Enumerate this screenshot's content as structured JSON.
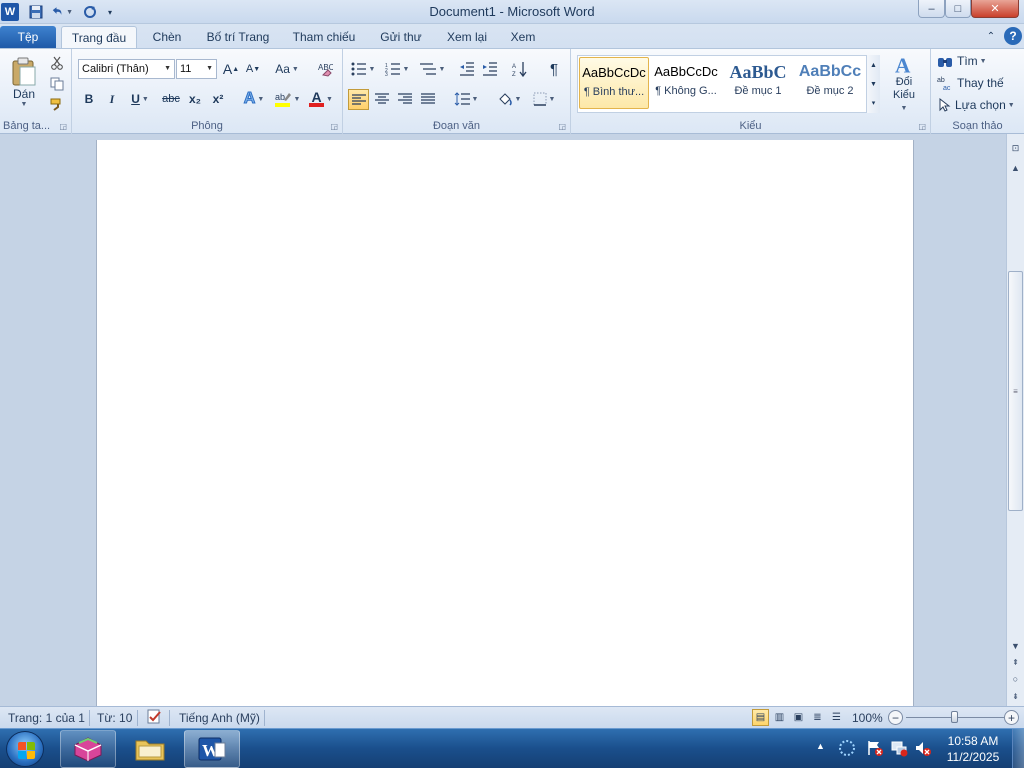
{
  "window": {
    "title": "Document1 - Microsoft Word",
    "app_icon": "word-icon",
    "controls": {
      "minimize": "–",
      "maximize": "□",
      "close": "✕"
    }
  },
  "quick_access": {
    "save": "save-icon",
    "undo": "undo-icon",
    "redo": "redo-icon",
    "customize": "customize-qat-icon"
  },
  "tabs": [
    {
      "label": "Tệp"
    },
    {
      "label": "Trang đầu"
    },
    {
      "label": "Chèn"
    },
    {
      "label": "Bố trí Trang"
    },
    {
      "label": "Tham chiếu"
    },
    {
      "label": "Gửi thư"
    },
    {
      "label": "Xem lại"
    },
    {
      "label": "Xem"
    }
  ],
  "ribbon": {
    "clipboard": {
      "label": "Bảng ta...",
      "paste_label": "Dán"
    },
    "font": {
      "label": "Phông",
      "font_name": "Calibri (Thân)",
      "font_size": "11",
      "bold": "B",
      "italic": "I",
      "underline": "U",
      "strike": "abc",
      "subscript": "x₂",
      "superscript": "x²",
      "grow": "A",
      "shrink": "A",
      "change_case": "Aa",
      "font_color_letter": "A"
    },
    "paragraph": {
      "label": "Đoạn văn",
      "pilcrow": "¶"
    },
    "styles": {
      "label": "Kiểu",
      "items": [
        {
          "preview": "AaBbCcDc",
          "name": "¶ Bình thư..."
        },
        {
          "preview": "AaBbCcDc",
          "name": "¶ Không G..."
        },
        {
          "preview": "AaBbC",
          "name": "Đề mục 1"
        },
        {
          "preview": "AaBbCc",
          "name": "Đề mục 2"
        }
      ],
      "change_styles": "Đổi Kiểu"
    },
    "editing": {
      "label": "Soạn thảo",
      "find": "Tìm",
      "replace": "Thay thế",
      "select": "Lựa chọn"
    }
  },
  "status": {
    "page": "Trang: 1 của 1",
    "words": "Từ: 10",
    "language": "Tiếng Anh (Mỹ)",
    "zoom": "100%",
    "zoom_level": 1.0
  },
  "taskbar": {
    "apps": [
      "app-icon",
      "folder-icon",
      "word-icon"
    ],
    "time": "10:58 AM",
    "date": "11/2/2025"
  },
  "colors": {
    "file_tab": "#2a6ab8",
    "highlight_yellow": "#ffff00",
    "font_color_red": "#e02020",
    "taskbar": "#1a4f8c"
  }
}
